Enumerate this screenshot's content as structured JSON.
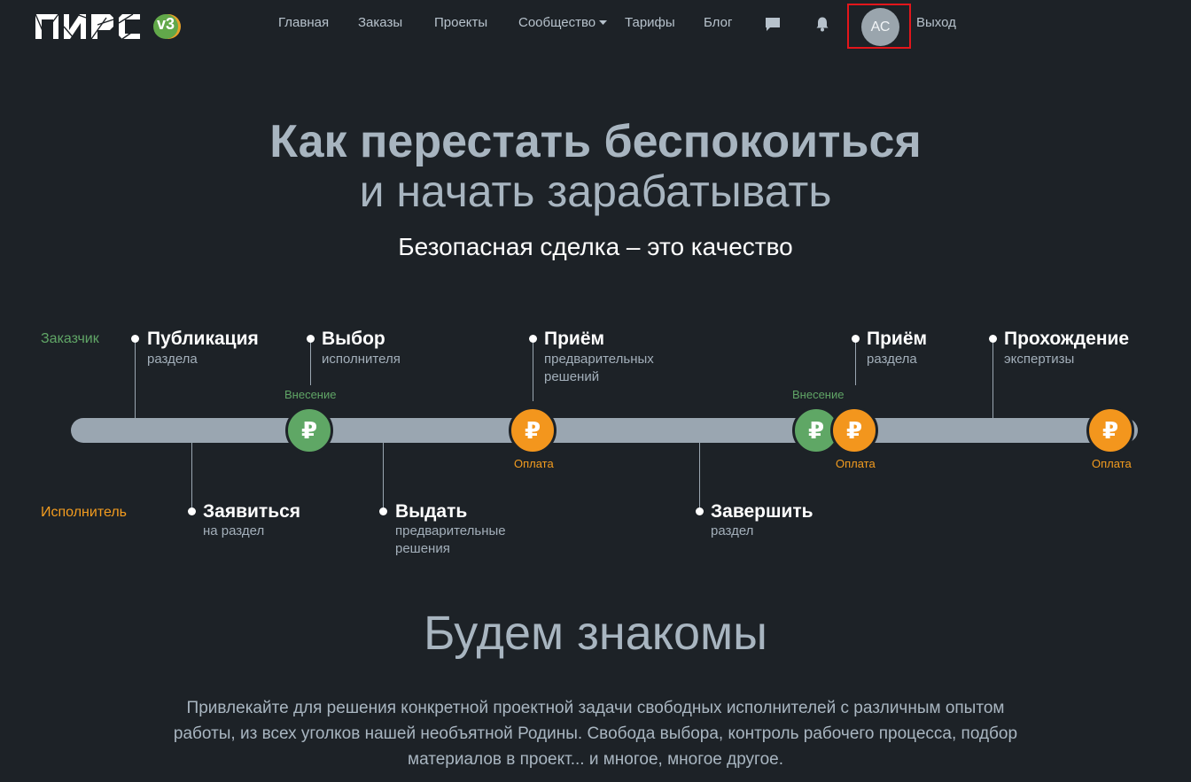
{
  "header": {
    "logo_text": "ПИРС",
    "logo_version": "v3",
    "nav": {
      "home": "Главная",
      "orders": "Заказы",
      "projects": "Проекты",
      "community": "Сообщество",
      "tariffs": "Тарифы",
      "blog": "Блог"
    },
    "avatar_initials": "АС",
    "logout": "Выход"
  },
  "hero": {
    "title_bold": "Как перестать беспокоиться",
    "title_light": "и начать зарабатывать",
    "subtitle": "Безопасная сделка – это качество"
  },
  "timeline": {
    "roles": {
      "customer": "Заказчик",
      "executor": "Исполнитель"
    },
    "customer_steps": [
      {
        "title": "Публикация",
        "sub": "раздела"
      },
      {
        "title": "Выбор",
        "sub": "исполнителя"
      },
      {
        "title": "Приём",
        "sub": "предварительных решений"
      },
      {
        "title": "Приём",
        "sub": "раздела"
      },
      {
        "title": "Прохождение",
        "sub": "экспертизы"
      }
    ],
    "executor_steps": [
      {
        "title": "Заявиться",
        "sub": "на раздел"
      },
      {
        "title": "Выдать",
        "sub": "предварительные решения"
      },
      {
        "title": "Завершить",
        "sub": "раздел"
      }
    ],
    "coin_symbol": "₽",
    "coin_labels": {
      "deposit1": "Внесение",
      "payment1": "Оплата",
      "deposit2": "Внесение",
      "payment2": "Оплата",
      "payment3": "Оплата"
    },
    "colors": {
      "deposit": "#5fa765",
      "payment": "#f3961d",
      "track": "#9aa6b1"
    }
  },
  "about": {
    "title": "Будем знакомы",
    "text": "Привлекайте для решения конкретной проектной задачи свободных исполнителей с различным опытом работы, из всех уголков нашей необъятной Родины. Свобода выбора, контроль рабочего процесса, подбор материалов в проект... и многое, многое другое."
  },
  "icons": [
    "chat-icon",
    "bell-icon",
    "chevron-down-icon",
    "ruble-icon"
  ]
}
